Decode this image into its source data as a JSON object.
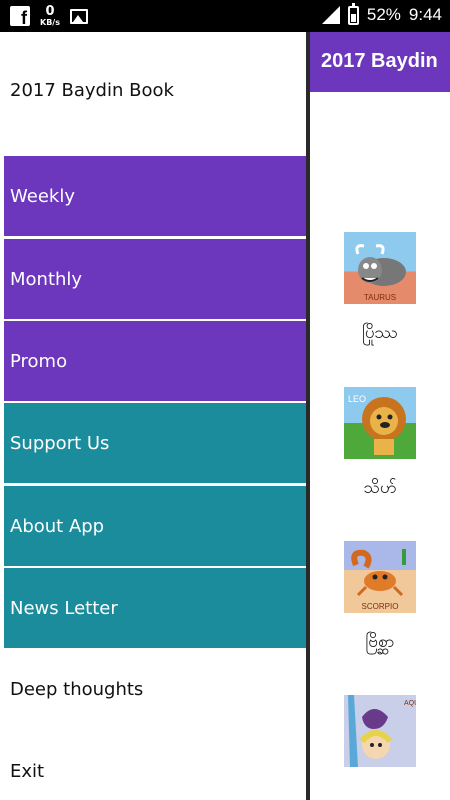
{
  "status_bar": {
    "speed_value": "0",
    "speed_unit": "KB/s",
    "battery": "52%",
    "time": "9:44"
  },
  "app": {
    "title": "2017 Baydin",
    "zodiac": [
      {
        "caption": "TAURUS",
        "label": "ပြိုဿ",
        "icon": "taurus-icon"
      },
      {
        "caption": "LEO",
        "label": "သိဟ်",
        "icon": "leo-icon"
      },
      {
        "caption": "SCORPIO",
        "label": "ဗြိစ္ဆာ",
        "icon": "scorpio-icon"
      },
      {
        "caption": "AQUARIUS",
        "label": "",
        "icon": "aquarius-icon"
      }
    ]
  },
  "drawer": {
    "title": "2017 Baydin Book",
    "items": [
      {
        "label": "Weekly"
      },
      {
        "label": "Monthly"
      },
      {
        "label": "Promo"
      },
      {
        "label": "Support Us"
      },
      {
        "label": "About App"
      },
      {
        "label": "News Letter"
      },
      {
        "label": "Deep thoughts"
      },
      {
        "label": "Exit"
      }
    ]
  },
  "colors": {
    "purple": "#6c36bd",
    "teal": "#1b8c9b"
  }
}
